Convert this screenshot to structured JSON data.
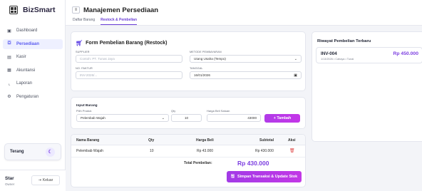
{
  "app": {
    "brand": "BizSmart"
  },
  "sidebar": {
    "items": [
      {
        "label": "Dashboard",
        "icon": "dashboard-icon",
        "active": false
      },
      {
        "label": "Persediaan",
        "icon": "box-icon",
        "active": true
      },
      {
        "label": "Kasir",
        "icon": "cash-register-icon",
        "active": false
      },
      {
        "label": "Akuntansi",
        "icon": "ledger-icon",
        "active": false
      },
      {
        "label": "Laporan",
        "icon": "chart-icon",
        "active": false
      },
      {
        "label": "Pengaturan",
        "icon": "gear-icon",
        "active": false
      }
    ],
    "theme_label": "Terang",
    "user": {
      "name": "Star",
      "role": "Owner",
      "logout_label": "Keluar"
    }
  },
  "header": {
    "title": "Manajemen Persediaan",
    "tabs": [
      {
        "label": "Daftar Barang",
        "active": false
      },
      {
        "label": "Restock & Pembelian",
        "active": true
      }
    ]
  },
  "form": {
    "title": "Form Pembelian Barang (Restock)",
    "supplier": {
      "label": "SUPPLIER",
      "placeholder": "Contoh: PT. Tunas Jaya",
      "value": ""
    },
    "payment": {
      "label": "METODE PEMBAYARAN",
      "value": "Utang Usaha (Tempo)"
    },
    "invoice": {
      "label": "NO. FAKTUR",
      "placeholder": "INV-2026/...",
      "value": ""
    },
    "date": {
      "label": "TANGGAL",
      "value": "16/01/2026"
    }
  },
  "input_items": {
    "title": "Input Barang",
    "product": {
      "label": "Pilih Produk",
      "value": "Pelembab Wajah"
    },
    "qty": {
      "label": "Qty",
      "value": "10"
    },
    "price": {
      "label": "Harga Beli Satuan",
      "value": "43000"
    },
    "add_label": "+ Tambah"
  },
  "table": {
    "columns": [
      "Nama Barang",
      "Qty",
      "Harga Beli",
      "Subtotal",
      "Aksi"
    ],
    "rows": [
      {
        "name": "Pelembab Wajah",
        "qty": "10",
        "price": "Rp 43.000",
        "subtotal": "Rp 430.000"
      }
    ],
    "total_label": "Total Pembelian:",
    "total_value": "Rp 430.000",
    "save_label": "Simpan Transaksi & Update Stok"
  },
  "history": {
    "title": "Riwayat Pembelian Terbaru",
    "items": [
      {
        "id": "INV-004",
        "meta": "1/13/2026 • Cahaya • Tunai",
        "amount": "Rp 450.000"
      }
    ]
  },
  "colors": {
    "accent": "#7d3fe0",
    "button_gradient_start": "#a23be6",
    "button_gradient_end": "#c237e6",
    "danger": "#e04848"
  }
}
